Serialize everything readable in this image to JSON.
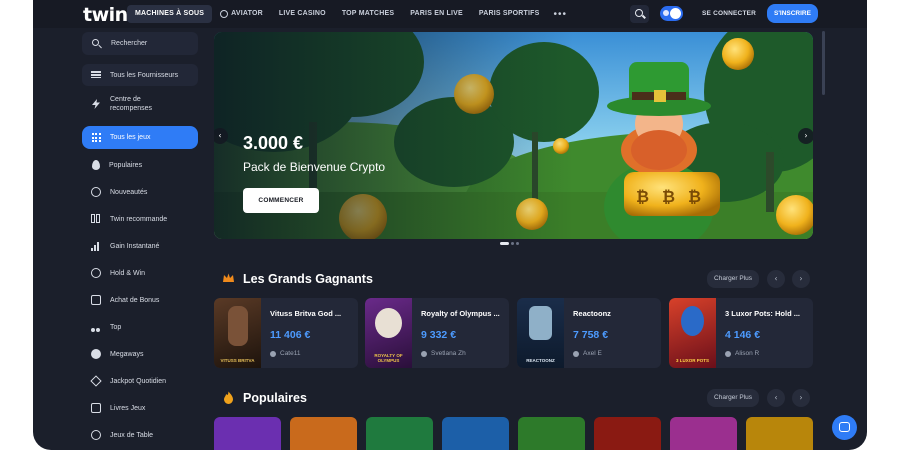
{
  "brand": {
    "logo": "twin"
  },
  "nav": {
    "items": [
      {
        "label": "MACHINES À SOUS",
        "active": true
      },
      {
        "label": "AVIATOR"
      },
      {
        "label": "LIVE CASINO"
      },
      {
        "label": "TOP MATCHES"
      },
      {
        "label": "PARIS EN LIVE"
      },
      {
        "label": "PARIS SPORTIFS"
      }
    ],
    "more": "•••",
    "login": "SE CONNECTER",
    "signup": "S'INSCRIRE"
  },
  "sidebar": {
    "search": "Rechercher",
    "providers": "Tous les Fournisseurs",
    "rewards": "Centre de recompenses",
    "items": [
      {
        "label": "Tous les jeux",
        "icon": "grid-icon",
        "active": true
      },
      {
        "label": "Populaires",
        "icon": "flame-icon"
      },
      {
        "label": "Nouveautés",
        "icon": "new-badge-icon"
      },
      {
        "label": "Twin recommande",
        "icon": "cards-icon"
      },
      {
        "label": "Gain Instantané",
        "icon": "bars-icon"
      },
      {
        "label": "Hold & Win",
        "icon": "coin-icon"
      },
      {
        "label": "Achat de Bonus",
        "icon": "gift-icon"
      },
      {
        "label": "Top",
        "icon": "cherries-icon"
      },
      {
        "label": "Megaways",
        "icon": "burst-icon"
      },
      {
        "label": "Jackpot Quotidien",
        "icon": "diamond-icon"
      },
      {
        "label": "Livres Jeux",
        "icon": "book-icon"
      },
      {
        "label": "Jeux de Table",
        "icon": "chip-icon"
      }
    ]
  },
  "hero": {
    "amount": "3.000 €",
    "subtitle": "Pack de Bienvenue Crypto",
    "cta": "COMMENCER",
    "slides": 3,
    "active_slide": 1
  },
  "winners": {
    "title": "Les Grands Gagnants",
    "load_more": "Charger Plus",
    "cards": [
      {
        "game": "Vituss Britva God ...",
        "amount": "11 406 €",
        "user": "Cate11",
        "thumb_text": "VITUSS BRITVA"
      },
      {
        "game": "Royalty of Olympus ...",
        "amount": "9 332 €",
        "user": "Svetlana Zh",
        "thumb_text": "ROYALTY OF OLYMPUS"
      },
      {
        "game": "Reactoonz",
        "amount": "7 758 €",
        "user": "Axel E",
        "thumb_text": "REACTOONZ"
      },
      {
        "game": "3 Luxor Pots: Hold ...",
        "amount": "4 146 €",
        "user": "Alison R",
        "thumb_text": "3 LUXOR POTS"
      }
    ]
  },
  "popular": {
    "title": "Populaires",
    "load_more": "Charger Plus",
    "tile_colors": [
      "#6b2fb0",
      "#c96a1c",
      "#1f7a3e",
      "#1c5fa8",
      "#2d7a2a",
      "#8a1a12",
      "#9b2f8f",
      "#b8860b"
    ]
  },
  "colors": {
    "accent": "#2f7cf6",
    "background": "#1b1f2b",
    "amount": "#4d9bff"
  }
}
